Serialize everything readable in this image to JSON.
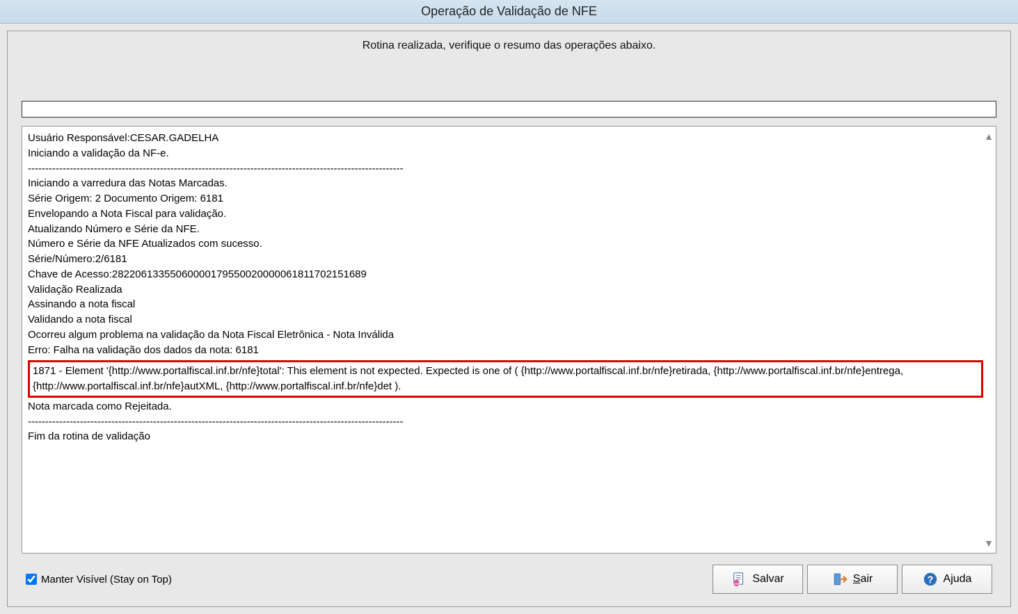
{
  "window": {
    "title": "Operação de Validação de NFE"
  },
  "status": {
    "message": "Rotina realizada, verifique o resumo das operações abaixo."
  },
  "log": {
    "line1": "Usuário Responsável:CESAR.GADELHA",
    "line2": "Iniciando a validação da NF-e.",
    "sep1": "------------------------------------------------------------------------------------------------------------",
    "line3": "Iniciando a varredura das Notas Marcadas.",
    "line4": "Série Origem: 2 Documento Origem: 6181",
    "line5": "Envelopando a Nota Fiscal para validação.",
    "line6": "Atualizando Número e Série da NFE.",
    "line7": "Número e Série da NFE Atualizados com sucesso.",
    "line8": "Série/Número:2/6181",
    "line9": "Chave de Acesso:28220613355060000179550020000061811702151689",
    "line10": "Validação Realizada",
    "line11": "Assinando a nota fiscal",
    "line12": "Validando a nota fiscal",
    "line13": "Ocorreu algum problema na validação da Nota Fiscal Eletrônica - Nota Inválida",
    "line14": "Erro: Falha na validação dos dados da nota: 6181",
    "highlight": "1871 - Element '{http://www.portalfiscal.inf.br/nfe}total': This element is not expected. Expected is one of ( {http://www.portalfiscal.inf.br/nfe}retirada, {http://www.portalfiscal.inf.br/nfe}entrega, {http://www.portalfiscal.inf.br/nfe}autXML, {http://www.portalfiscal.inf.br/nfe}det ).",
    "line15": "Nota marcada como Rejeitada.",
    "sep2": "------------------------------------------------------------------------------------------------------------",
    "line16": "Fim da rotina de validação"
  },
  "footer": {
    "stay_on_top_label": "Manter Visível (Stay on Top)",
    "stay_on_top_checked": true,
    "save_label": "Salvar",
    "exit_prefix": "S",
    "exit_suffix": "air",
    "help_label": "Ajuda"
  }
}
